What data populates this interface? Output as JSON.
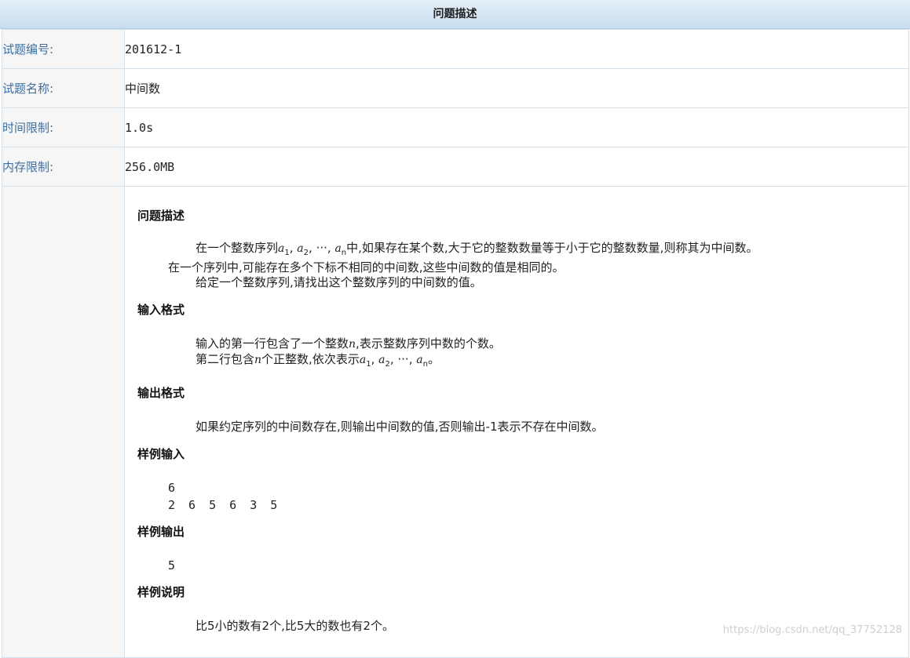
{
  "header": {
    "title": "问题描述"
  },
  "info": {
    "id_label": "试题编号:",
    "id_value": "201612-1",
    "name_label": "试题名称:",
    "name_value": "中间数",
    "time_label": "时间限制:",
    "time_value": "1.0s",
    "mem_label": "内存限制:",
    "mem_value": "256.0MB"
  },
  "problem": {
    "desc_heading": "问题描述",
    "desc_p1_a": "在一个整数序列",
    "desc_p1_b": "中,如果存在某个数,大于它的整数数量等于小于它的整数数量,则称其为中间数。",
    "desc_p2": "在一个序列中,可能存在多个下标不相同的中间数,这些中间数的值是相同的。",
    "desc_p3": "给定一个整数序列,请找出这个整数序列的中间数的值。",
    "input_heading": "输入格式",
    "input_p1_a": "输入的第一行包含了一个整数",
    "input_p1_b": ",表示整数序列中数的个数。",
    "input_p2_a": "第二行包含",
    "input_p2_b": "个正整数,依次表示",
    "output_heading": "输出格式",
    "output_p1": "如果约定序列的中间数存在,则输出中间数的值,否则输出-1表示不存在中间数。",
    "sample_in_heading": "样例输入",
    "sample_in_line1": "6",
    "sample_in_line2": "2 6 5 6 3 5",
    "sample_out_heading": "样例输出",
    "sample_out_line1": "5",
    "explain_heading": "样例说明",
    "explain_p1": "比5小的数有2个,比5大的数也有2个。"
  },
  "math": {
    "a": "a",
    "n": "n",
    "sub1": "1",
    "sub2": "2",
    "subn": "n",
    "sep": ", ",
    "ellipsis": "···",
    "dot": "。"
  },
  "watermark": "https://blog.csdn.net/qq_37752128"
}
